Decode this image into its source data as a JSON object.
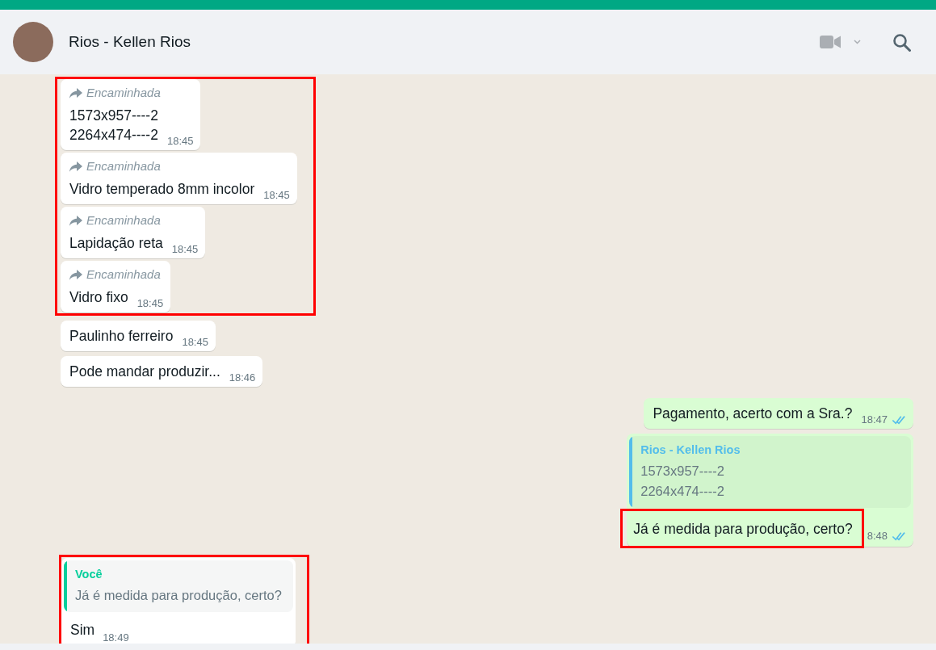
{
  "header": {
    "title": "Rios - Kellen Rios"
  },
  "messages": [
    {
      "kind": "incoming",
      "forward_label": "Encaminhada",
      "text": "1573x957----2\n2264x474----2",
      "time": "18:45",
      "highlighted": true
    },
    {
      "kind": "incoming",
      "forward_label": "Encaminhada",
      "text": "Vidro temperado 8mm incolor",
      "time": "18:45",
      "highlighted": true
    },
    {
      "kind": "incoming",
      "forward_label": "Encaminhada",
      "text": "Lapidação reta",
      "time": "18:45",
      "highlighted": true
    },
    {
      "kind": "incoming",
      "forward_label": "Encaminhada",
      "text": "Vidro fixo",
      "time": "18:45",
      "highlighted": true
    },
    {
      "kind": "incoming",
      "text": "Paulinho ferreiro",
      "time": "18:45",
      "highlighted": false
    },
    {
      "kind": "incoming",
      "text": "Pode mandar produzir...",
      "time": "18:46",
      "highlighted": false
    },
    {
      "kind": "outgoing",
      "text": "Pagamento, acerto com a Sra.?",
      "time": "18:47",
      "read": true,
      "highlighted": false,
      "text_highlighted": false
    },
    {
      "kind": "outgoing",
      "quote": {
        "author": "Rios - Kellen Rios",
        "text": "1573x957----2\n2264x474----2",
        "color": "#53bdeb"
      },
      "text": "Já é medida para produção, certo?",
      "time": "8:48",
      "read": true,
      "highlighted": false,
      "text_highlighted": true
    },
    {
      "kind": "incoming",
      "quote": {
        "author": "Você",
        "text": "Já é medida para produção, certo?",
        "color": "#06cf9c"
      },
      "text": "Sim",
      "time": "18:49",
      "highlighted": true
    }
  ]
}
